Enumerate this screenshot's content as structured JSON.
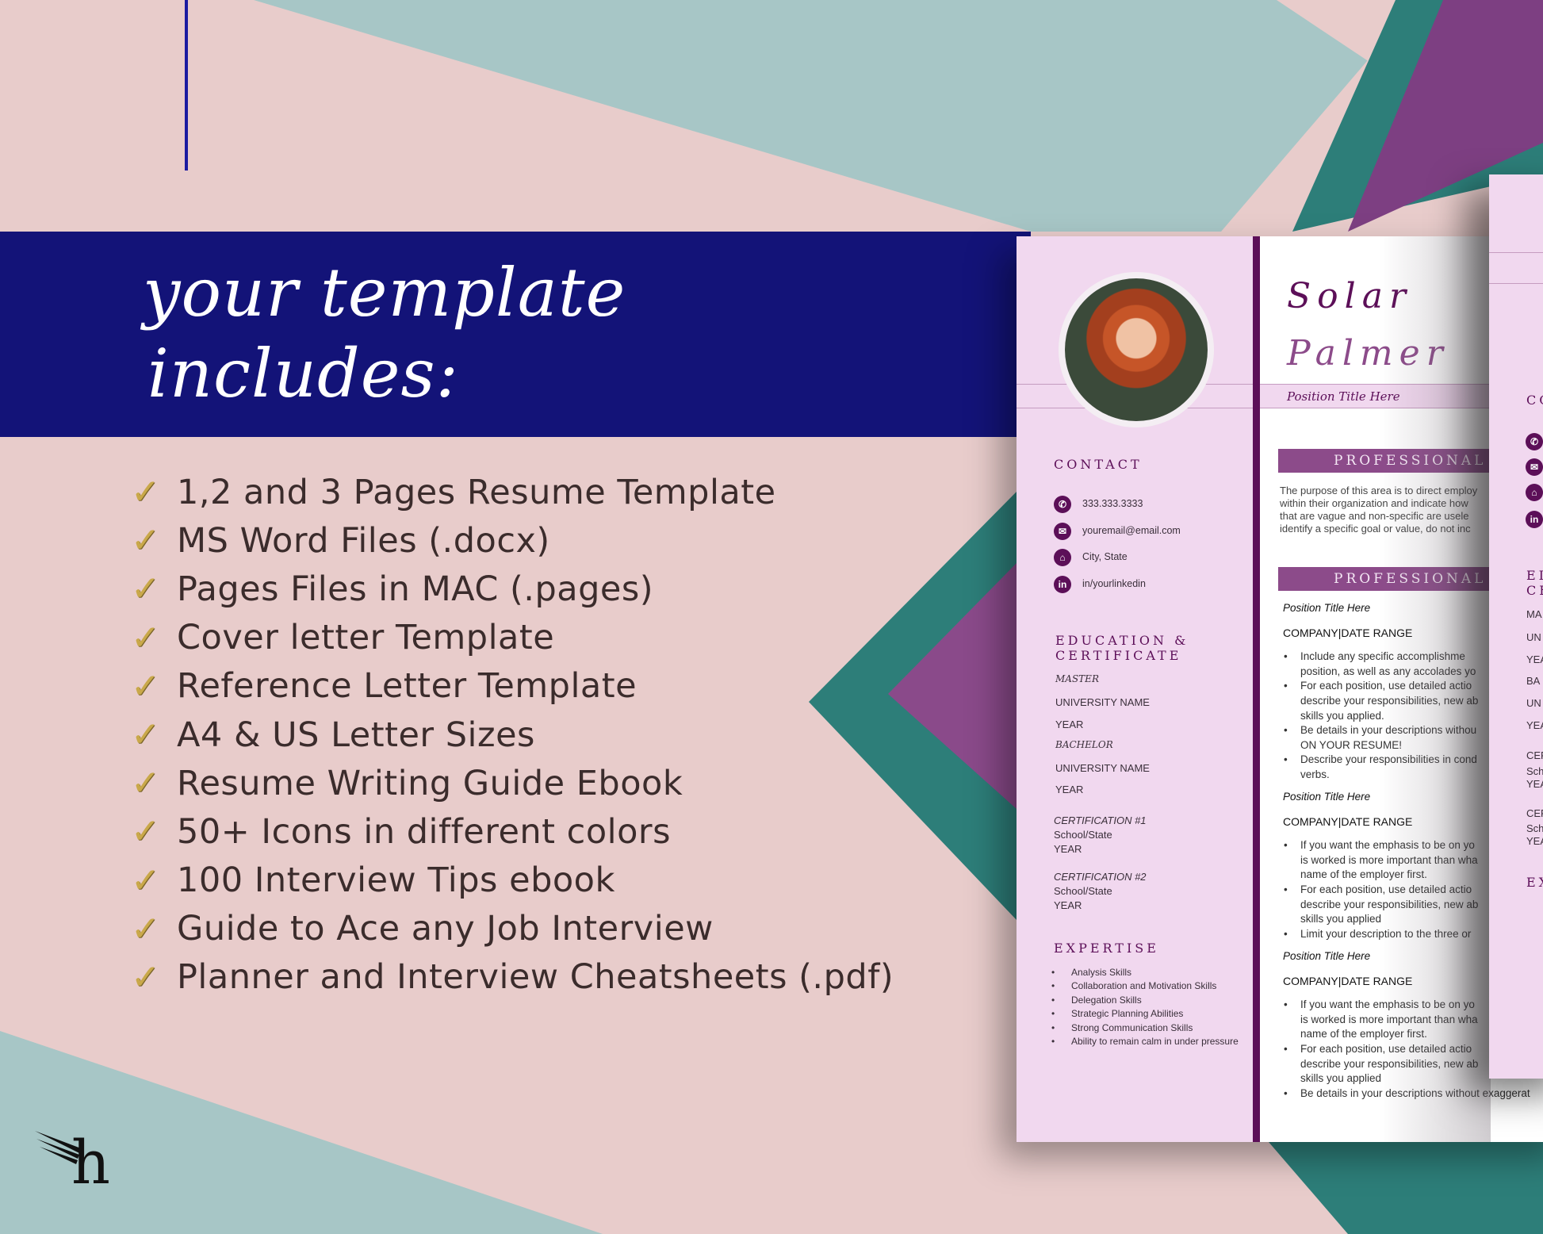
{
  "colors": {
    "navy": "#131378",
    "pink": "#e8cccb",
    "teal": "#a7c6c6",
    "plum": "#5c0f58",
    "lavender": "#f1d8ef",
    "gold": "#c9a84a"
  },
  "heading": {
    "line1": "your template",
    "line2": "includes:"
  },
  "features": [
    "1,2 and 3 Pages Resume Template",
    "MS Word Files (.docx)",
    "Pages Files in MAC (.pages)",
    "Cover letter Template",
    "Reference Letter Template",
    "A4 & US Letter Sizes",
    "Resume Writing Guide Ebook",
    "50+ Icons in different colors",
    "100 Interview Tips ebook",
    "Guide to Ace any Job Interview",
    "Planner and Interview Cheatsheets (.pdf)"
  ],
  "check_icon": "✓",
  "logo": {
    "letter": "h",
    "icon": "wing-icon"
  },
  "resume": {
    "first_name": "Solar",
    "last_name": "Palmer",
    "position": "Position Title Here",
    "contact_heading": "CONTACT",
    "contact": [
      {
        "icon": "phone-icon",
        "glyph": "✆",
        "text": "333.333.3333"
      },
      {
        "icon": "email-icon",
        "glyph": "✉",
        "text": "youremail@email.com"
      },
      {
        "icon": "home-icon",
        "glyph": "⌂",
        "text": "City, State"
      },
      {
        "icon": "linkedin-icon",
        "glyph": "in",
        "text": "in/yourlinkedin"
      }
    ],
    "education_heading": [
      "EDUCATION &",
      "CERTIFICATE"
    ],
    "education": {
      "master": "MASTER",
      "uni1": "UNIVERSITY NAME",
      "year1": "YEAR",
      "bachelor": "BACHELOR",
      "uni2": "UNIVERSITY NAME",
      "year2": "YEAR"
    },
    "certs": [
      {
        "title": "CERTIFICATION #1",
        "school": "School/State",
        "year": "YEAR"
      },
      {
        "title": "CERTIFICATION #2",
        "school": "School/State",
        "year": "YEAR"
      }
    ],
    "expertise_heading": "EXPERTISE",
    "expertise": [
      "Analysis Skills",
      "Collaboration and Motivation Skills",
      "Delegation Skills",
      "Strategic Planning Abilities",
      "Strong Communication Skills",
      "Ability to remain calm in under pressure"
    ],
    "summary_heading": "PROFESSIONAL S",
    "summary": [
      "The purpose of this area is to direct employ",
      "within their organization and indicate how",
      "that are vague and non-specific are usele",
      "identify a specific goal or value, do not inc"
    ],
    "experience_heading": "PROFESSIONAL EX",
    "jobs": [
      {
        "title": "Position Title Here",
        "company": "COMPANY|DATE RANGE",
        "bullets": [
          [
            "Include any specific accomplishme",
            "position, as well as any accolades yo"
          ],
          [
            "For each position, use detailed actio",
            "describe your responsibilities, new ab",
            "skills you applied."
          ],
          [
            "Be details in your descriptions withou",
            "ON YOUR RESUME!"
          ],
          [
            "Describe your responsibilities in cond",
            "verbs."
          ]
        ]
      },
      {
        "title": "Position Title Here",
        "company": "COMPANY|DATE RANGE",
        "bullets": [
          [
            "If you want the emphasis to be on yo",
            "is worked is more important than wha",
            "name of the employer first."
          ],
          [
            "For each position, use detailed actio",
            "describe your responsibilities, new ab",
            "skills you applied"
          ],
          [
            "Limit your description to the three or"
          ]
        ]
      },
      {
        "title": "Position Title Here",
        "company": "COMPANY|DATE RANGE",
        "bullets": [
          [
            "If you want the emphasis to be on yo",
            "is worked is more important than wha",
            "name of the employer first."
          ],
          [
            "For each position, use detailed actio",
            "describe your responsibilities, new ab",
            "skills you applied"
          ],
          [
            "Be details in your descriptions without exaggerat"
          ]
        ]
      }
    ]
  },
  "page2": {
    "contact": "CO",
    "edu": [
      "EI",
      "CE"
    ],
    "lines": [
      "MA",
      "UN",
      "YEA",
      "BA",
      "UN",
      "YEA",
      "CER",
      "Sch",
      "YEA",
      "CER",
      "Sch",
      "YEA"
    ],
    "expertise": "EX"
  }
}
